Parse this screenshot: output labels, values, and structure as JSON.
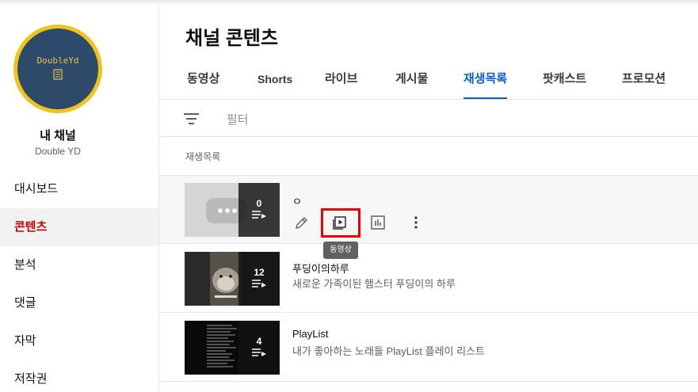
{
  "sidebar": {
    "avatar_text": "DoubleYd",
    "channel_name": "내 채널",
    "channel_handle": "Double YD",
    "items": [
      {
        "label": "대시보드"
      },
      {
        "label": "콘텐츠"
      },
      {
        "label": "분석"
      },
      {
        "label": "댓글"
      },
      {
        "label": "자막"
      },
      {
        "label": "저작권"
      }
    ]
  },
  "main": {
    "title": "채널 콘텐츠",
    "tabs": [
      {
        "label": "동영상"
      },
      {
        "label": "Shorts"
      },
      {
        "label": "라이브"
      },
      {
        "label": "게시물"
      },
      {
        "label": "재생목록"
      },
      {
        "label": "팟캐스트"
      },
      {
        "label": "프로모션"
      }
    ],
    "active_tab": "재생목록",
    "filter_placeholder": "필터",
    "column_header": "재생목록",
    "tooltip": "동영상",
    "playlists": [
      {
        "title": "ㅇ",
        "description": "",
        "count": "0"
      },
      {
        "title": "푸딩이의하루",
        "description": "새로운 가족이된 햄스터 푸딩이의 하루",
        "count": "12"
      },
      {
        "title": "PlayList",
        "description": "내가 좋아하는 노래들 PlayList 플레이 리스트",
        "count": "4"
      }
    ]
  },
  "colors": {
    "accent": "#065fd4",
    "active_nav": "#cc0000",
    "highlight_box": "#ee0000",
    "avatar_ring": "#f2c318",
    "avatar_bg": "#2e4a6b"
  }
}
